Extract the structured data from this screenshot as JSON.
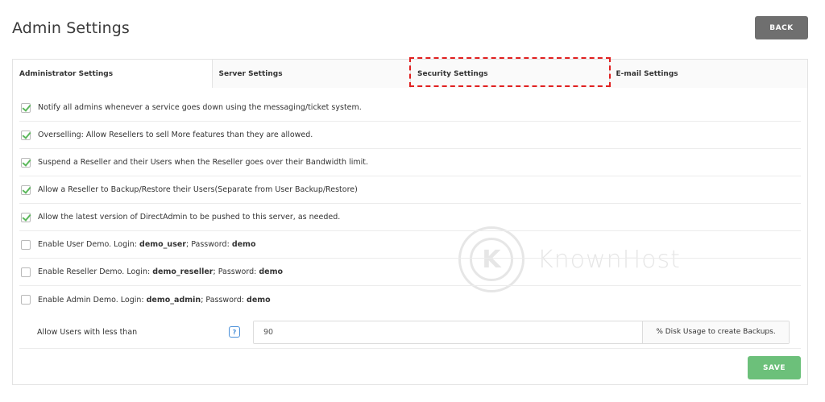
{
  "header": {
    "title": "Admin Settings",
    "back_label": "BACK"
  },
  "tabs": [
    {
      "label": "Administrator Settings",
      "active": true
    },
    {
      "label": "Server Settings",
      "active": false
    },
    {
      "label": "Security Settings",
      "active": false,
      "highlighted": true
    },
    {
      "label": "E-mail Settings",
      "active": false
    }
  ],
  "options": [
    {
      "checked": true,
      "text": "Notify all admins whenever a service goes down using the messaging/ticket system."
    },
    {
      "checked": true,
      "text": "Overselling: Allow Resellers to sell More features than they are allowed."
    },
    {
      "checked": true,
      "text": "Suspend a Reseller and their Users when the Reseller goes over their Bandwidth limit."
    },
    {
      "checked": true,
      "text": "Allow a Reseller to Backup/Restore their Users(Separate from User Backup/Restore)"
    },
    {
      "checked": true,
      "text": "Allow the latest version of DirectAdmin to be pushed to this server, as needed."
    },
    {
      "checked": false,
      "prefix": "Enable User Demo. Login: ",
      "login": "demo_user",
      "mid": "; Password: ",
      "password": "demo"
    },
    {
      "checked": false,
      "prefix": "Enable Reseller Demo. Login: ",
      "login": "demo_reseller",
      "mid": "; Password: ",
      "password": "demo"
    },
    {
      "checked": false,
      "prefix": "Enable Admin Demo. Login: ",
      "login": "demo_admin",
      "mid": "; Password: ",
      "password": "demo"
    }
  ],
  "backup": {
    "label": "Allow Users with less than",
    "help": "?",
    "value": "90",
    "suffix": "% Disk Usage to create Backups."
  },
  "save_label": "SAVE",
  "watermark": {
    "logo_letter": "K",
    "text": "KnownHost"
  },
  "colors": {
    "check": "#5cb85c",
    "save": "#6cc07a",
    "back": "#6f6f6f",
    "highlight": "#e02020",
    "help": "#4a90d9"
  }
}
